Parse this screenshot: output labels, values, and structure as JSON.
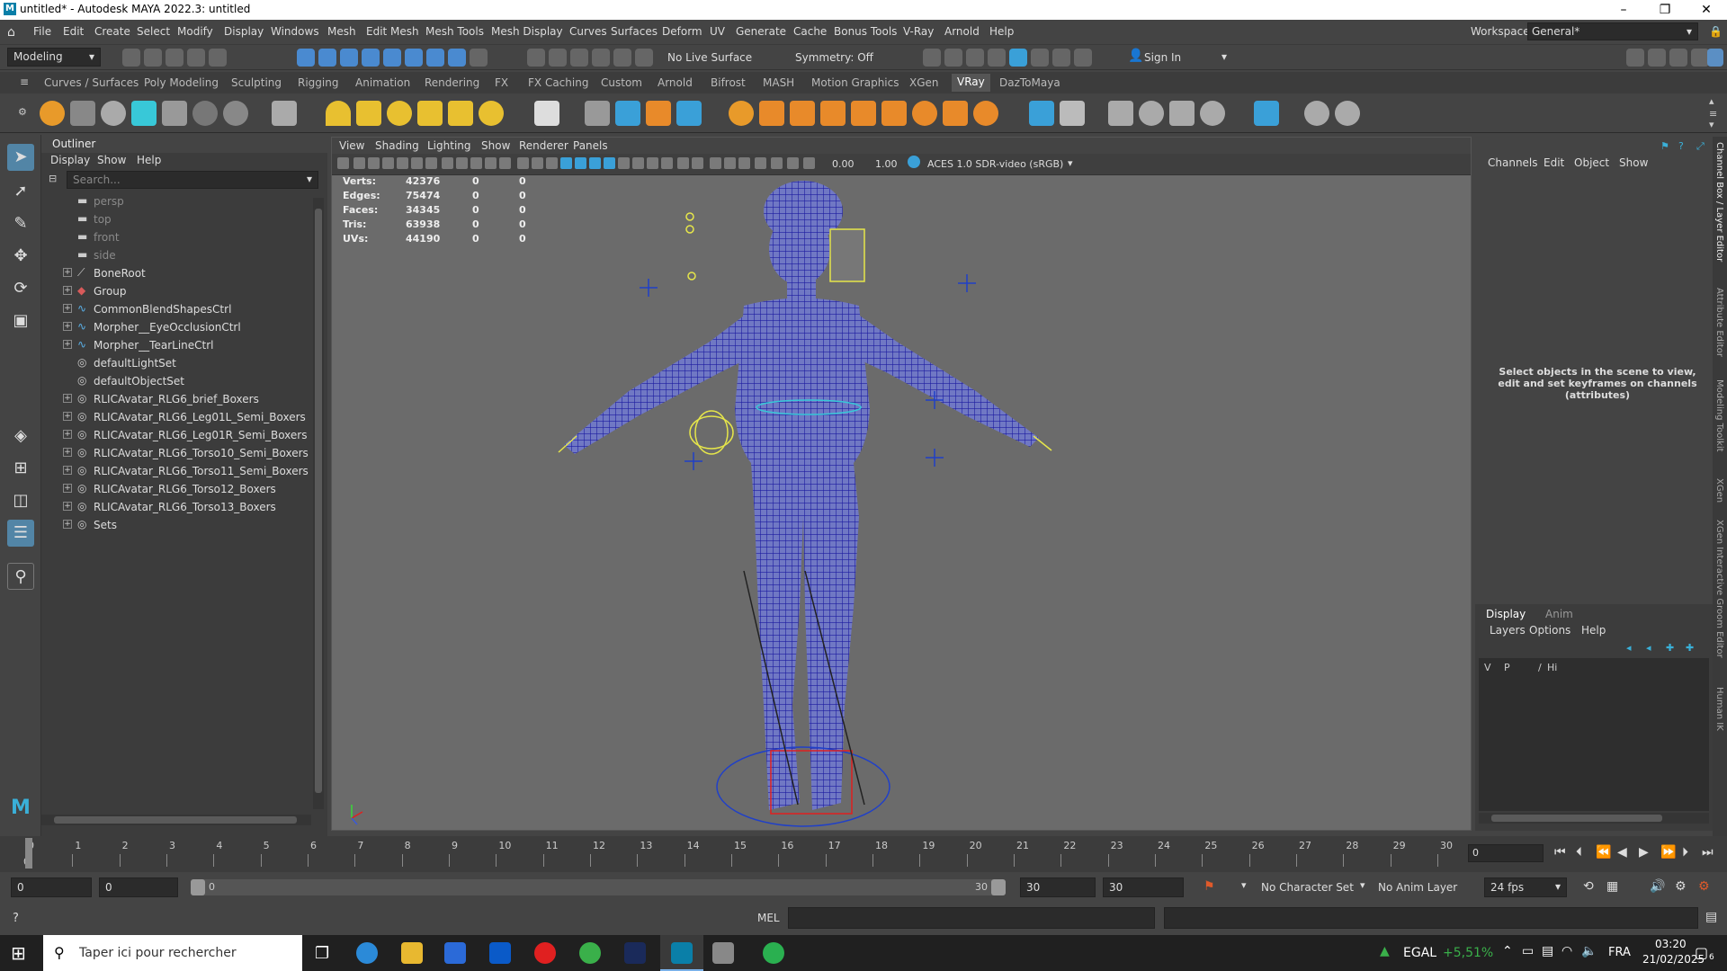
{
  "window": {
    "title": "untitled* - Autodesk MAYA 2022.3: untitled",
    "minimize": "–",
    "maximize": "❐",
    "close": "✕"
  },
  "menubar": {
    "items": [
      "File",
      "Edit",
      "Create",
      "Select",
      "Modify",
      "Display",
      "Windows",
      "Mesh",
      "Edit Mesh",
      "Mesh Tools",
      "Mesh Display",
      "Curves",
      "Surfaces",
      "Deform",
      "UV",
      "Generate",
      "Cache",
      "Bonus Tools",
      "V-Ray",
      "Arnold",
      "Help"
    ],
    "workspace_label": "Workspace:",
    "workspace_value": "General*"
  },
  "statusline": {
    "mode": "Modeling",
    "live_surface": "No Live Surface",
    "symmetry": "Symmetry: Off",
    "sign_in": "Sign In"
  },
  "shelf": {
    "tabs": [
      "Curves / Surfaces",
      "Poly Modeling",
      "Sculpting",
      "Rigging",
      "Animation",
      "Rendering",
      "FX",
      "FX Caching",
      "Custom",
      "Arnold",
      "Bifrost",
      "MASH",
      "Motion Graphics",
      "XGen",
      "VRay",
      "DazToMaya"
    ],
    "active": "VRay"
  },
  "outliner": {
    "title": "Outliner",
    "menu": [
      "Display",
      "Show",
      "Help"
    ],
    "search_placeholder": "Search...",
    "items": [
      {
        "label": "persp",
        "type": "camera",
        "dim": true
      },
      {
        "label": "top",
        "type": "camera",
        "dim": true
      },
      {
        "label": "front",
        "type": "camera",
        "dim": true
      },
      {
        "label": "side",
        "type": "camera",
        "dim": true
      },
      {
        "label": "BoneRoot",
        "type": "joint",
        "expand": true
      },
      {
        "label": "Group",
        "type": "group",
        "expand": true
      },
      {
        "label": "CommonBlendShapesCtrl",
        "type": "curve",
        "expand": true
      },
      {
        "label": "Morpher__EyeOcclusionCtrl",
        "type": "curve",
        "expand": true
      },
      {
        "label": "Morpher__TearLineCtrl",
        "type": "curve",
        "expand": true
      },
      {
        "label": "defaultLightSet",
        "type": "set"
      },
      {
        "label": "defaultObjectSet",
        "type": "set"
      },
      {
        "label": "RLICAvatar_RLG6_brief_Boxers",
        "type": "set",
        "expand": true
      },
      {
        "label": "RLICAvatar_RLG6_Leg01L_Semi_Boxers",
        "type": "set",
        "expand": true
      },
      {
        "label": "RLICAvatar_RLG6_Leg01R_Semi_Boxers",
        "type": "set",
        "expand": true
      },
      {
        "label": "RLICAvatar_RLG6_Torso10_Semi_Boxers",
        "type": "set",
        "expand": true
      },
      {
        "label": "RLICAvatar_RLG6_Torso11_Semi_Boxers",
        "type": "set",
        "expand": true
      },
      {
        "label": "RLICAvatar_RLG6_Torso12_Boxers",
        "type": "set",
        "expand": true
      },
      {
        "label": "RLICAvatar_RLG6_Torso13_Boxers",
        "type": "set",
        "expand": true
      },
      {
        "label": "Sets",
        "type": "set",
        "expand": true
      }
    ]
  },
  "viewport": {
    "menu": [
      "View",
      "Shading",
      "Lighting",
      "Show",
      "Renderer",
      "Panels"
    ],
    "near": "0.00",
    "far": "1.00",
    "colorspace": "ACES 1.0 SDR-video (sRGB)",
    "hud": [
      {
        "label": "Verts:",
        "v": "42376",
        "a": "0",
        "b": "0"
      },
      {
        "label": "Edges:",
        "v": "75474",
        "a": "0",
        "b": "0"
      },
      {
        "label": "Faces:",
        "v": "34345",
        "a": "0",
        "b": "0"
      },
      {
        "label": "Tris:",
        "v": "63938",
        "a": "0",
        "b": "0"
      },
      {
        "label": "UVs:",
        "v": "44190",
        "a": "0",
        "b": "0"
      }
    ],
    "mesh_color": "#2a2aa8",
    "ctrl_yellow": "#e6e64a",
    "ctrl_cyan": "#38c8d8",
    "ctrl_red": "#e02020"
  },
  "channel_box": {
    "menu": [
      "Channels",
      "Edit",
      "Object",
      "Show"
    ],
    "hint": "Select objects in the scene to view, edit and set keyframes on channels (attributes)",
    "layer_tabs": [
      "Display",
      "Anim"
    ],
    "layer_menu": [
      "Layers",
      "Options",
      "Help"
    ],
    "layer_cols": [
      "V",
      "P",
      "/",
      "Hi"
    ]
  },
  "side_tabs": [
    "Channel Box / Layer Editor",
    "Attribute Editor",
    "Modeling Toolkit",
    "XGen",
    "XGen Interactive Groom Editor",
    "Human IK"
  ],
  "timeline": {
    "ticks": [
      "0",
      "1",
      "2",
      "3",
      "4",
      "5",
      "6",
      "7",
      "8",
      "9",
      "10",
      "11",
      "12",
      "13",
      "14",
      "15",
      "16",
      "17",
      "18",
      "19",
      "20",
      "21",
      "22",
      "23",
      "24",
      "25",
      "26",
      "27",
      "28",
      "29",
      "30"
    ],
    "current": "0",
    "current_field": "0"
  },
  "range": {
    "start": "0",
    "start2": "0",
    "slider_start": "0",
    "slider_end": "30",
    "end": "30",
    "end2": "30",
    "char_set": "No Character Set",
    "anim_layer": "No Anim Layer",
    "fps": "24 fps"
  },
  "cmdline": {
    "lang": "MEL"
  },
  "taskbar": {
    "search": "Taper ici pour rechercher",
    "stock": "EGAL",
    "stock_change": "+5,51%",
    "lang": "FRA",
    "time": "03:20",
    "date": "21/02/2025",
    "notif": "6"
  }
}
